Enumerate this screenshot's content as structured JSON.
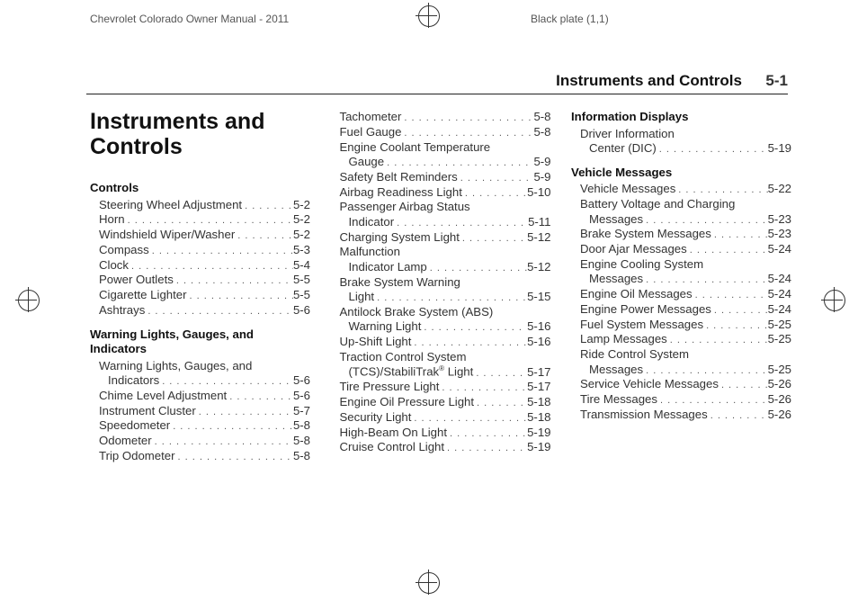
{
  "header": {
    "left": "Chevrolet Colorado Owner Manual - 2011",
    "right": "Black plate (1,1)"
  },
  "section": {
    "title": "Instruments and Controls",
    "page": "5-1"
  },
  "chapter_title": "Instruments and Controls",
  "groups": {
    "controls": {
      "title": "Controls",
      "items": [
        {
          "label": "Steering Wheel Adjustment",
          "page": "5-2"
        },
        {
          "label": "Horn",
          "page": "5-2"
        },
        {
          "label": "Windshield Wiper/Washer",
          "page": "5-2"
        },
        {
          "label": "Compass",
          "page": "5-3"
        },
        {
          "label": "Clock",
          "page": "5-4"
        },
        {
          "label": "Power Outlets",
          "page": "5-5"
        },
        {
          "label": "Cigarette Lighter",
          "page": "5-5"
        },
        {
          "label": "Ashtrays",
          "page": "5-6"
        }
      ]
    },
    "wlgi": {
      "title": "Warning Lights, Gauges, and Indicators",
      "items_a": [
        {
          "label_line1": "Warning Lights, Gauges, and",
          "label_line2": "Indicators",
          "page": "5-6"
        },
        {
          "label": "Chime Level Adjustment",
          "page": "5-6"
        },
        {
          "label": "Instrument Cluster",
          "page": "5-7"
        },
        {
          "label": "Speedometer",
          "page": "5-8"
        },
        {
          "label": "Odometer",
          "page": "5-8"
        },
        {
          "label": "Trip Odometer",
          "page": "5-8"
        }
      ],
      "items_b": [
        {
          "label": "Tachometer",
          "page": "5-8"
        },
        {
          "label": "Fuel Gauge",
          "page": "5-8"
        },
        {
          "label_line1": "Engine Coolant Temperature",
          "label_line2": "Gauge",
          "page": "5-9"
        },
        {
          "label": "Safety Belt Reminders",
          "page": "5-9"
        },
        {
          "label": "Airbag Readiness Light",
          "page": "5-10"
        },
        {
          "label_line1": "Passenger Airbag Status",
          "label_line2": "Indicator",
          "page": "5-11"
        },
        {
          "label": "Charging System Light",
          "page": "5-12"
        },
        {
          "label_line1": "Malfunction",
          "label_line2": "Indicator Lamp",
          "page": "5-12"
        },
        {
          "label_line1": "Brake System Warning",
          "label_line2": "Light",
          "page": "5-15"
        },
        {
          "label_line1": "Antilock Brake System (ABS)",
          "label_line2": "Warning Light",
          "page": "5-16"
        },
        {
          "label": "Up-Shift Light",
          "page": "5-16"
        },
        {
          "label_line1": "Traction Control System",
          "label_line2_html": "(TCS)/StabiliTrak<sup class='reg'>®</sup> Light",
          "page": "5-17"
        },
        {
          "label": "Tire Pressure Light",
          "page": "5-17"
        },
        {
          "label": "Engine Oil Pressure Light",
          "page": "5-18"
        },
        {
          "label": "Security Light",
          "page": "5-18"
        },
        {
          "label": "High-Beam On Light",
          "page": "5-19"
        },
        {
          "label": "Cruise Control Light",
          "page": "5-19"
        }
      ]
    },
    "info_displays": {
      "title": "Information Displays",
      "items": [
        {
          "label_line1": "Driver Information",
          "label_line2": "Center (DIC)",
          "page": "5-19"
        }
      ]
    },
    "vehicle_messages": {
      "title": "Vehicle Messages",
      "items": [
        {
          "label": "Vehicle Messages",
          "page": "5-22"
        },
        {
          "label_line1": "Battery Voltage and Charging",
          "label_line2": "Messages",
          "page": "5-23"
        },
        {
          "label": "Brake System Messages",
          "page": "5-23"
        },
        {
          "label": "Door Ajar Messages",
          "page": "5-24"
        },
        {
          "label_line1": "Engine Cooling System",
          "label_line2": "Messages",
          "page": "5-24"
        },
        {
          "label": "Engine Oil Messages",
          "page": "5-24"
        },
        {
          "label": "Engine Power Messages",
          "page": "5-24"
        },
        {
          "label": "Fuel System Messages",
          "page": "5-25"
        },
        {
          "label": "Lamp Messages",
          "page": "5-25"
        },
        {
          "label_line1": "Ride Control System",
          "label_line2": "Messages",
          "page": "5-25"
        },
        {
          "label": "Service Vehicle Messages",
          "page": "5-26"
        },
        {
          "label": "Tire Messages",
          "page": "5-26"
        },
        {
          "label": "Transmission Messages",
          "page": "5-26"
        }
      ]
    }
  }
}
